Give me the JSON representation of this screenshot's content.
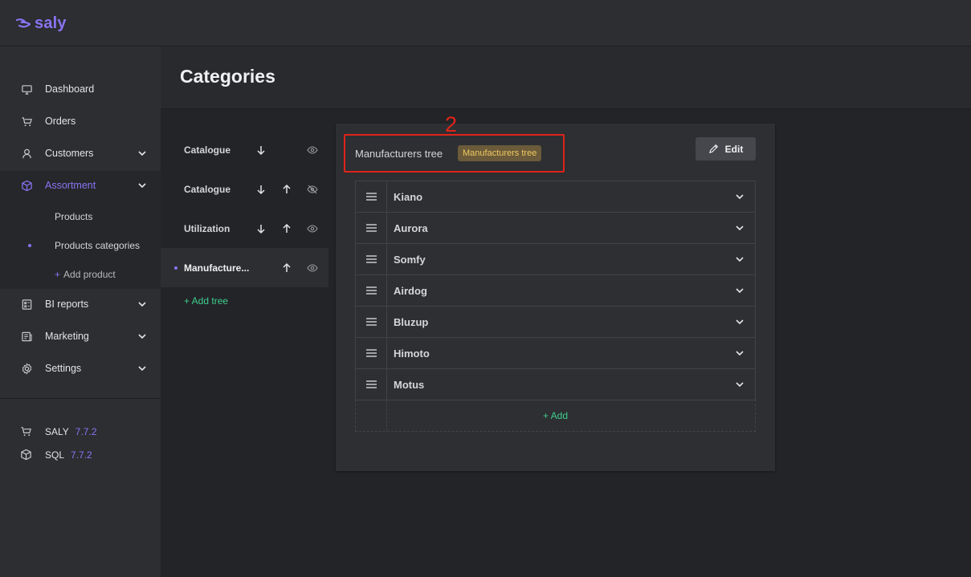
{
  "app": {
    "logo_text": "saly",
    "brand_color": "#8a73f3"
  },
  "sidebar": {
    "items": [
      {
        "label": "Dashboard",
        "icon": "monitor-icon"
      },
      {
        "label": "Orders",
        "icon": "cart-icon"
      },
      {
        "label": "Customers",
        "icon": "user-icon"
      },
      {
        "label": "Assortment",
        "icon": "box-icon"
      },
      {
        "label": "BI reports",
        "icon": "report-icon"
      },
      {
        "label": "Marketing",
        "icon": "newspaper-icon"
      },
      {
        "label": "Settings",
        "icon": "gear-icon"
      }
    ],
    "assortment_sub": {
      "products": "Products",
      "products_categories": "Products categories",
      "add_product": "Add product",
      "add_prefix": "+"
    },
    "versions": [
      {
        "label": "SALY",
        "version": "7.7.2"
      },
      {
        "label": "SQL",
        "version": "7.7.2"
      }
    ]
  },
  "header": {
    "title": "Categories"
  },
  "trees": {
    "items": [
      {
        "name": "Catalogue"
      },
      {
        "name": "Catalogue"
      },
      {
        "name": "Utilization"
      },
      {
        "name": "Manufacture..."
      }
    ],
    "add_label": "+ Add tree"
  },
  "panel": {
    "title": "Manufacturers tree",
    "badge": "Manufacturers tree",
    "badge_color": "#f0c860",
    "annotation_number": "2",
    "edit_label": "Edit",
    "rows": [
      {
        "name": "Kiano"
      },
      {
        "name": "Aurora"
      },
      {
        "name": "Somfy"
      },
      {
        "name": "Airdog"
      },
      {
        "name": "Bluzup"
      },
      {
        "name": "Himoto"
      },
      {
        "name": "Motus"
      }
    ],
    "add_label": "+ Add"
  }
}
